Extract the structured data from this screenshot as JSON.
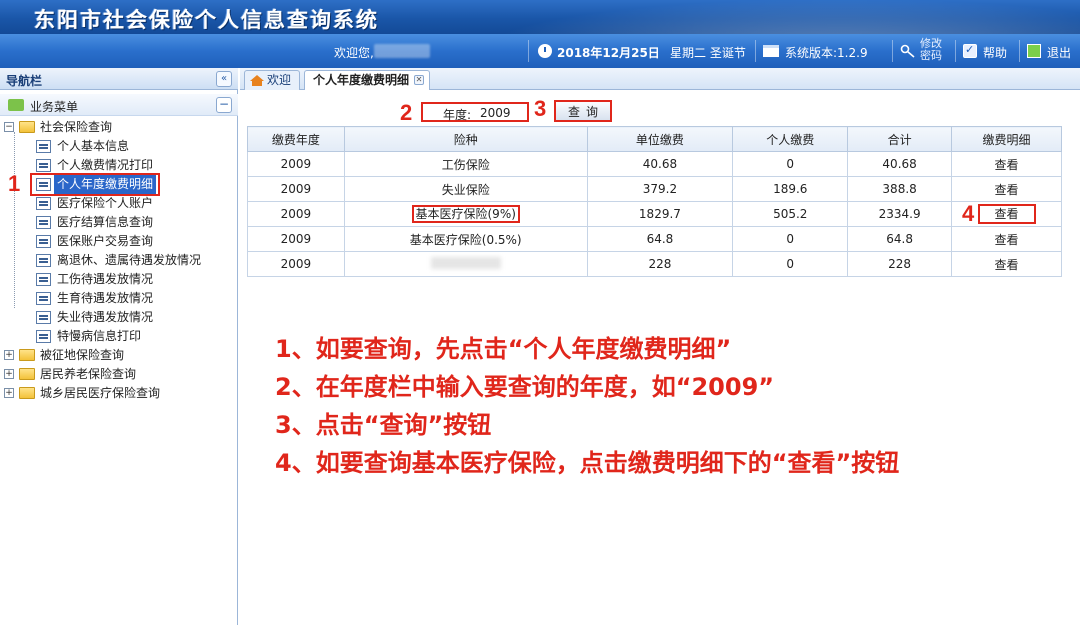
{
  "window": {
    "title": "东阳市社会保险个人信息查询系统"
  },
  "info_bar": {
    "welcome": "欢迎您,",
    "date": "2018年12月25日",
    "weekday": "星期二 圣诞节",
    "version": "系统版本:1.2.9",
    "change_password": "修改密码",
    "help": "帮助",
    "exit": "退出"
  },
  "nav": {
    "header": "导航栏",
    "collapse": "«",
    "menu_header": "业务菜单",
    "menu_collapse": "−",
    "tree": {
      "social_insurance": "社会保险查询",
      "items": [
        "个人基本信息",
        "个人缴费情况打印",
        "个人年度缴费明细",
        "医疗保险个人账户",
        "医疗结算信息查询",
        "医保账户交易查询",
        "离退休、遗属待遇发放情况",
        "工伤待遇发放情况",
        "生育待遇发放情况",
        "失业待遇发放情况",
        "特慢病信息打印"
      ],
      "others": [
        "被征地保险查询",
        "居民养老保险查询",
        "城乡居民医疗保险查询"
      ]
    }
  },
  "tabs": {
    "welcome": "欢迎",
    "active": "个人年度缴费明细"
  },
  "query": {
    "year_label": "年度:",
    "year_value": "2009",
    "button": "查询"
  },
  "table": {
    "headers": [
      "缴费年度",
      "险种",
      "单位缴费",
      "个人缴费",
      "合计",
      "缴费明细"
    ],
    "rows": [
      [
        "2009",
        "工伤保险",
        "40.68",
        "0",
        "40.68",
        "查看"
      ],
      [
        "2009",
        "失业保险",
        "379.2",
        "189.6",
        "388.8",
        "查看"
      ],
      [
        "2009",
        "基本医疗保险(9%)",
        "1829.7",
        "505.2",
        "2334.9",
        "查看"
      ],
      [
        "2009",
        "基本医疗保险(0.5%)",
        "64.8",
        "0",
        "64.8",
        "查看"
      ],
      [
        "2009",
        "",
        "228",
        "0",
        "228",
        "查看"
      ]
    ]
  },
  "annotations": {
    "steps": [
      "1",
      "2",
      "3",
      "4"
    ],
    "instructions": [
      "1、如要查询，先点击“个人年度缴费明细”",
      "2、在年度栏中输入要查询的年度，如“2009”",
      "3、点击“查询”按钮",
      "4、如要查询基本医疗保险，点击缴费明细下的“查看”按钮"
    ]
  }
}
